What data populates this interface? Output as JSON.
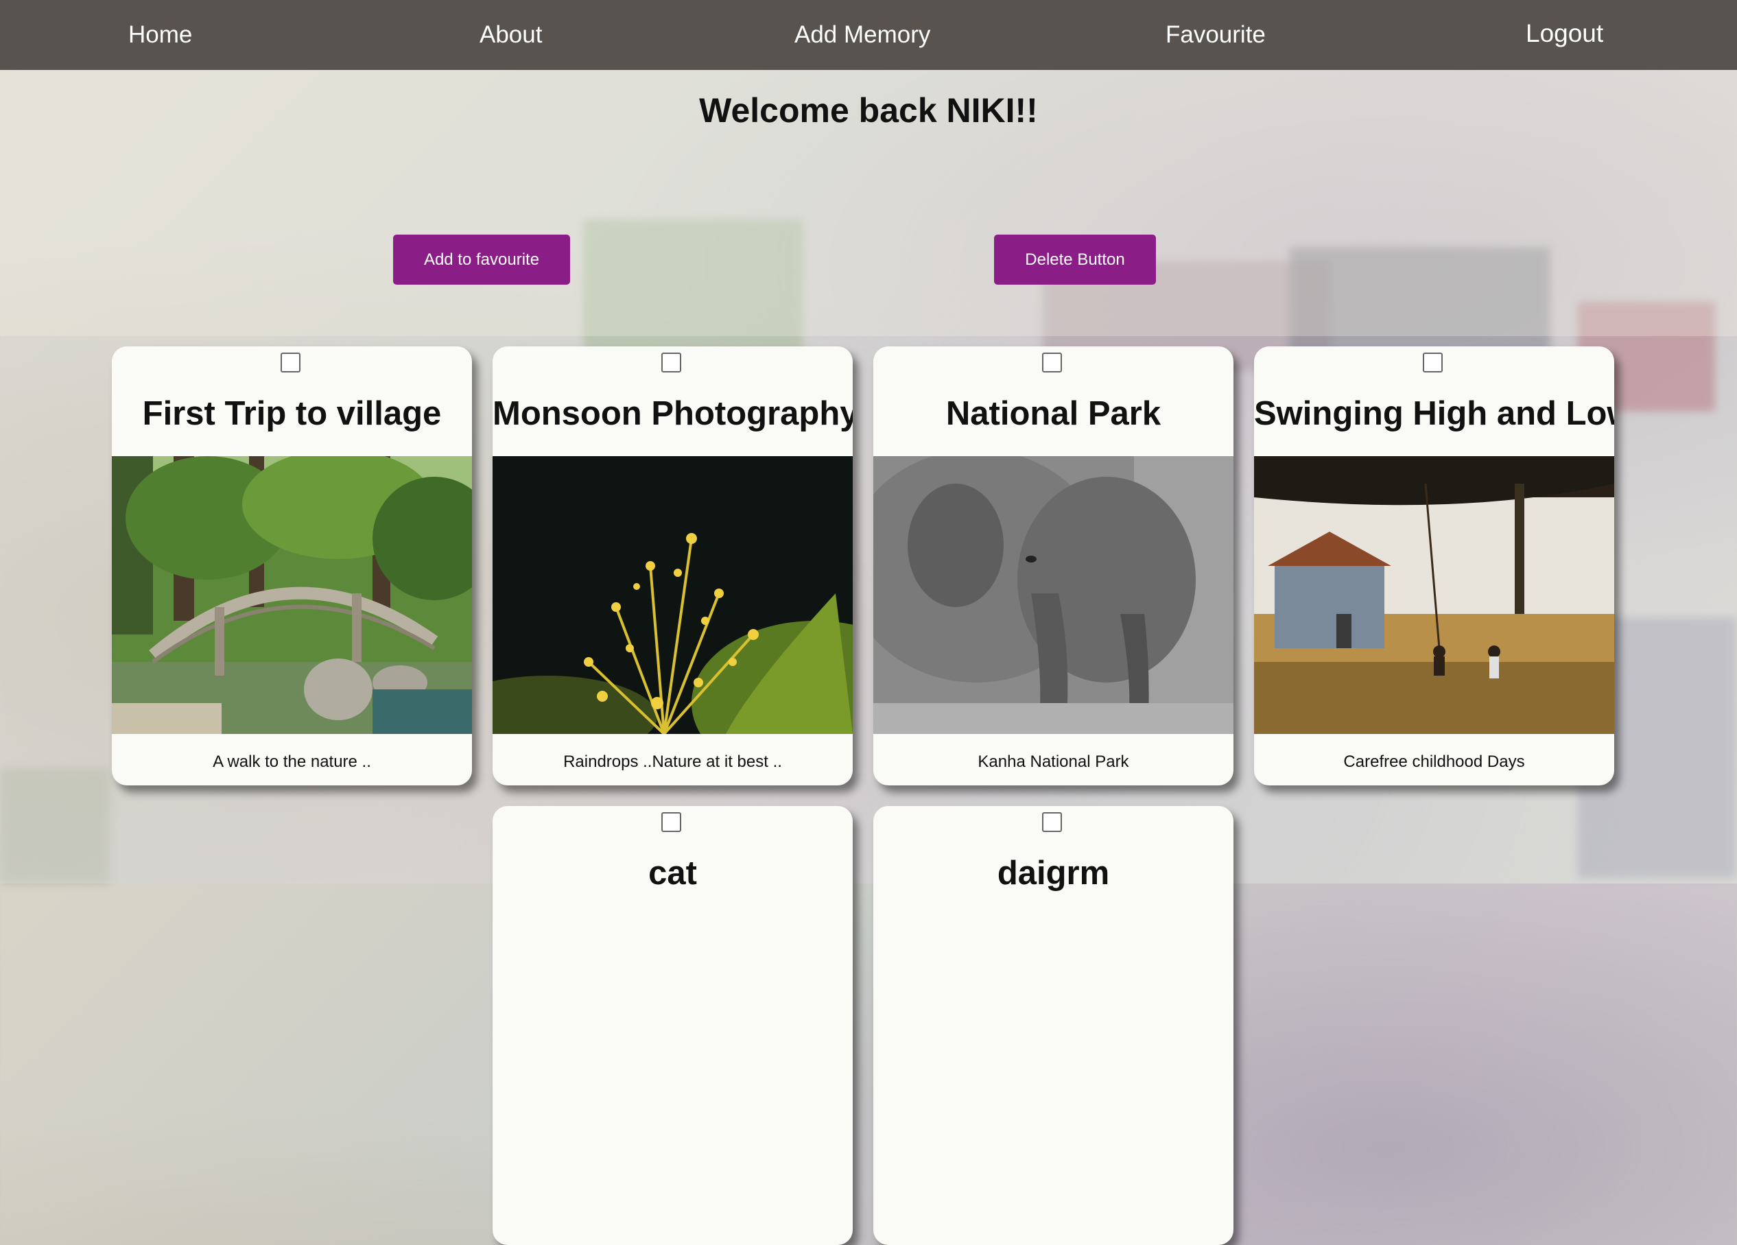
{
  "nav": {
    "home": "Home",
    "about": "About",
    "add_memory": "Add Memory",
    "favourite": "Favourite",
    "logout": "Logout"
  },
  "welcome": "Welcome back NIKI!!",
  "actions": {
    "add_to_favourite": "Add to favourite",
    "delete": "Delete Button"
  },
  "colors": {
    "navbar": "#58534f",
    "accent": "#8a1e86"
  },
  "memories": [
    {
      "title": "First Trip to village",
      "caption": "A walk to the nature ..",
      "image": "garden-bridge-photo"
    },
    {
      "title": "Monsoon Photography",
      "caption": "Raindrops ..Nature at it best ..",
      "image": "raindrops-plant-photo"
    },
    {
      "title": "National Park",
      "caption": "Kanha National Park",
      "image": "elephants-photo"
    },
    {
      "title": "Swinging High and Low",
      "caption": "Carefree childhood Days",
      "image": "children-swing-photo"
    },
    {
      "title": "cat",
      "caption": "",
      "image": ""
    },
    {
      "title": "daigrm",
      "caption": "",
      "image": ""
    }
  ]
}
